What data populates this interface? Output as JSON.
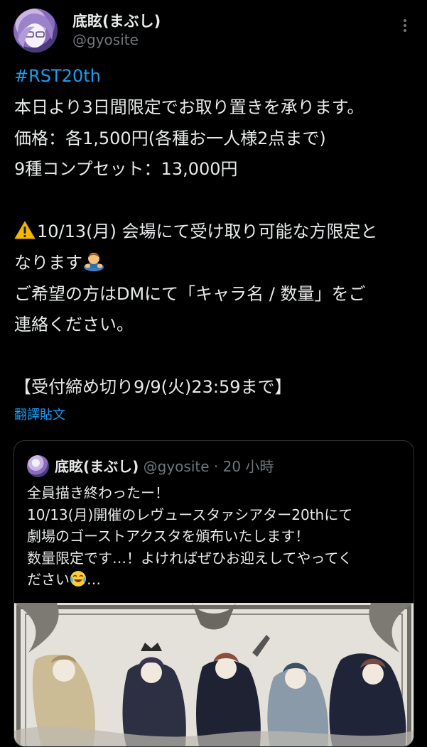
{
  "author": {
    "name": "底眩(まぶし)",
    "handle": "@gyosite"
  },
  "post": {
    "hashtag": "#RST20th",
    "lines": [
      "本日より3日間限定でお取り置きを承ります。",
      "価格：各1,500円(各種お一人様2点まで)",
      "9種コンプセット：13,000円",
      "",
      "10/13(月) 会場にて受け取り可能な方限定と",
      "なります",
      "ご希望の方はDMにて「キャラ名 / 数量」をご",
      "連絡ください。",
      "",
      "【受付締め切り9/9(火)23:59まで】"
    ],
    "icons": [
      "warning-icon",
      "bowing-person-emoji"
    ]
  },
  "translate_label": "翻譯貼文",
  "quoted": {
    "name": "底眩(まぶし)",
    "meta": "@gyosite · 20 小時",
    "lines": [
      "全員描き終わったー！",
      "10/13(月)開催のレヴュースタァシアター20thにて",
      "劇場のゴーストアクスタを頒布いたします！",
      "数量限定です…！よければぜひお迎えしてやってく",
      "ださい",
      "…"
    ],
    "icons": [
      "tears-of-joy-emoji"
    ]
  },
  "colors": {
    "background": "#000000",
    "text": "#e7e9ea",
    "secondary": "#71767b",
    "accent": "#1d9bf0",
    "border": "#2f3336"
  }
}
